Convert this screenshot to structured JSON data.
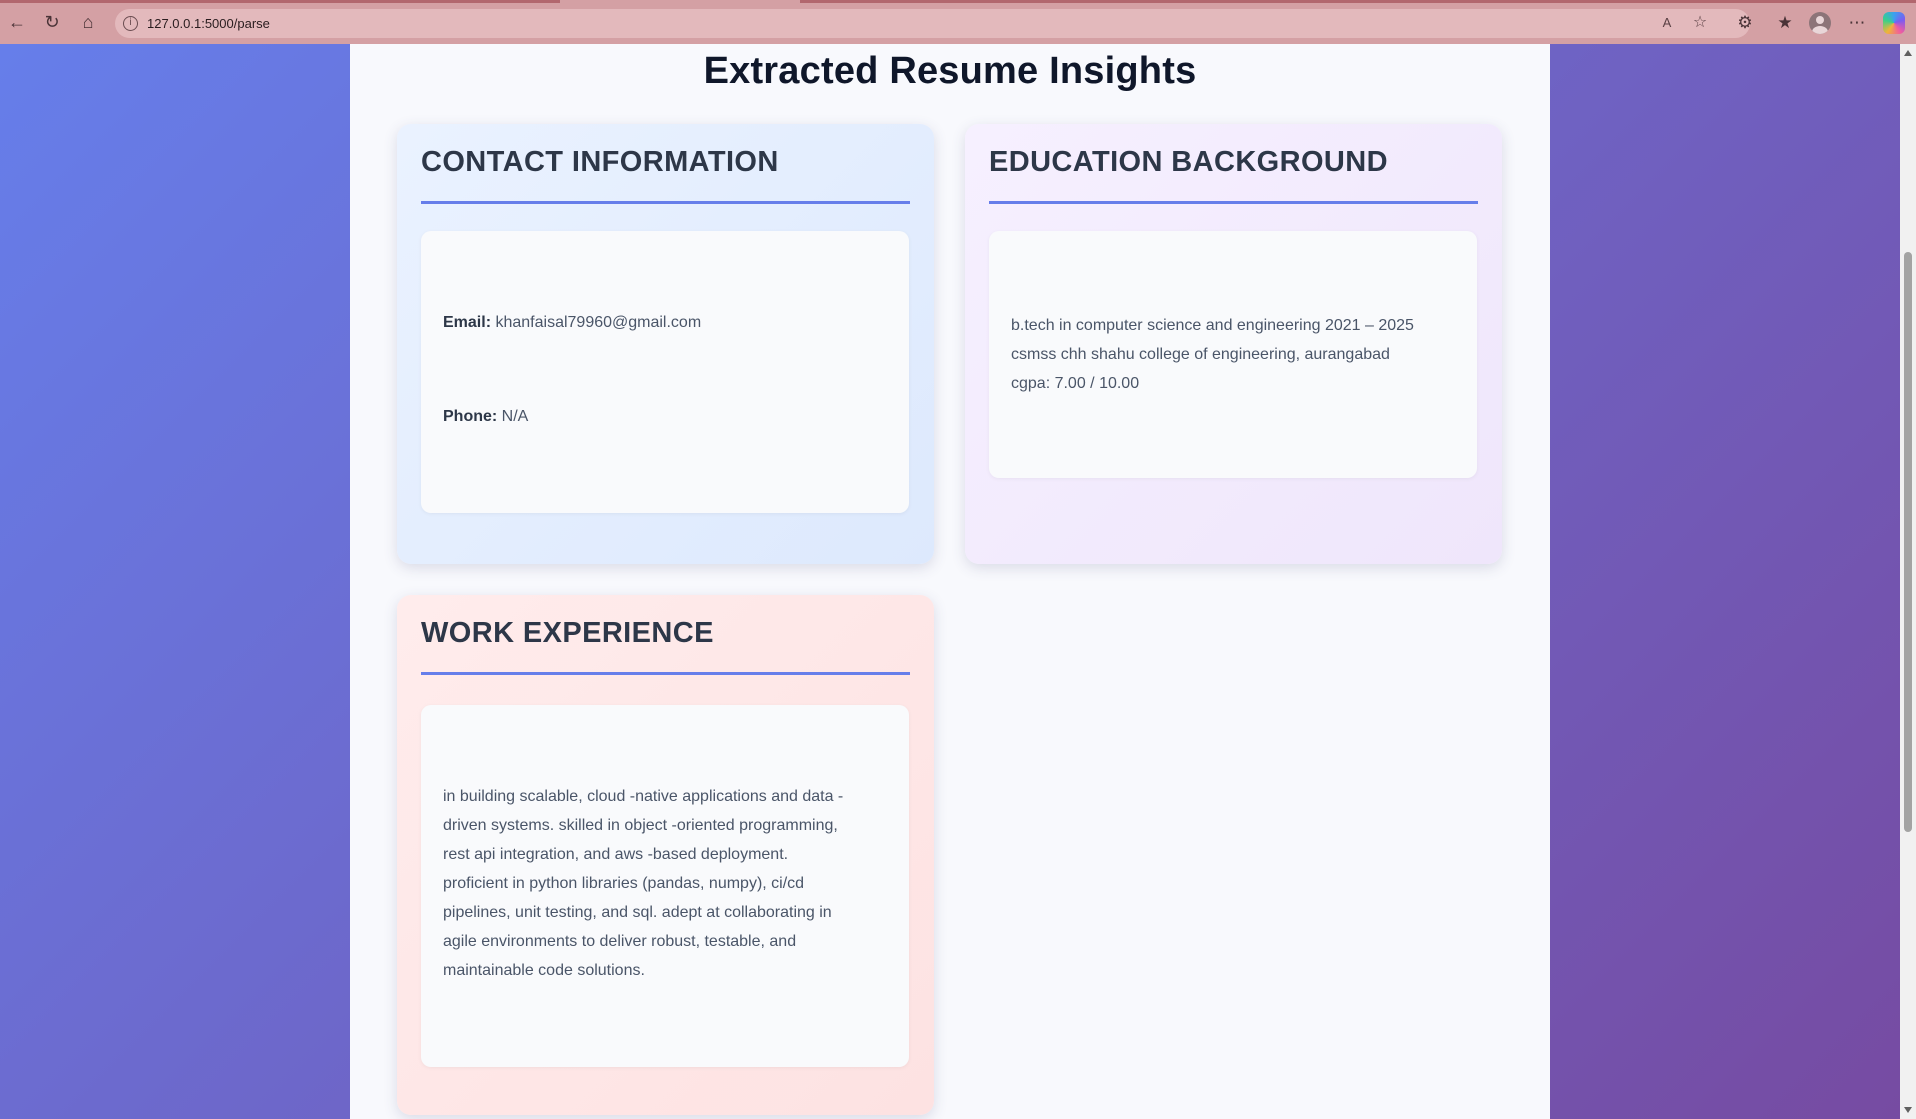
{
  "browser": {
    "url": "127.0.0.1:5000/parse"
  },
  "page": {
    "title": "Extracted Resume Insights"
  },
  "contact": {
    "heading": "CONTACT INFORMATION",
    "email_label": "Email:",
    "email_value": "khanfaisal79960@gmail.com",
    "phone_label": "Phone:",
    "phone_value": "N/A"
  },
  "education": {
    "heading": "EDUCATION BACKGROUND",
    "lines": [
      "b.tech in computer science and engineering 2021 – 2025",
      "csmss chh shahu college of engineering, aurangabad",
      "cgpa: 7.00 / 10.00"
    ]
  },
  "work": {
    "heading": "WORK EXPERIENCE",
    "lines": [
      "in building scalable, cloud -native applications and data -",
      "driven systems. skilled in object -oriented programming,",
      "rest api integration, and aws -based deployment.",
      "proficient in python libraries (pandas, numpy), ci/cd",
      "pipelines, unit testing, and sql. adept at collaborating in",
      "agile environments to deliver robust, testable, and",
      "maintainable code solutions."
    ]
  },
  "theme": {
    "accent": "#667eea",
    "background_start": "#667eea",
    "background_end": "#764ba2"
  },
  "icons": [
    "back-icon",
    "refresh-icon",
    "home-icon",
    "site-info-icon",
    "read-aloud-icon",
    "favorite-star-icon",
    "extensions-icon",
    "favorites-icon",
    "profile-icon",
    "more-icon",
    "copilot-icon"
  ]
}
